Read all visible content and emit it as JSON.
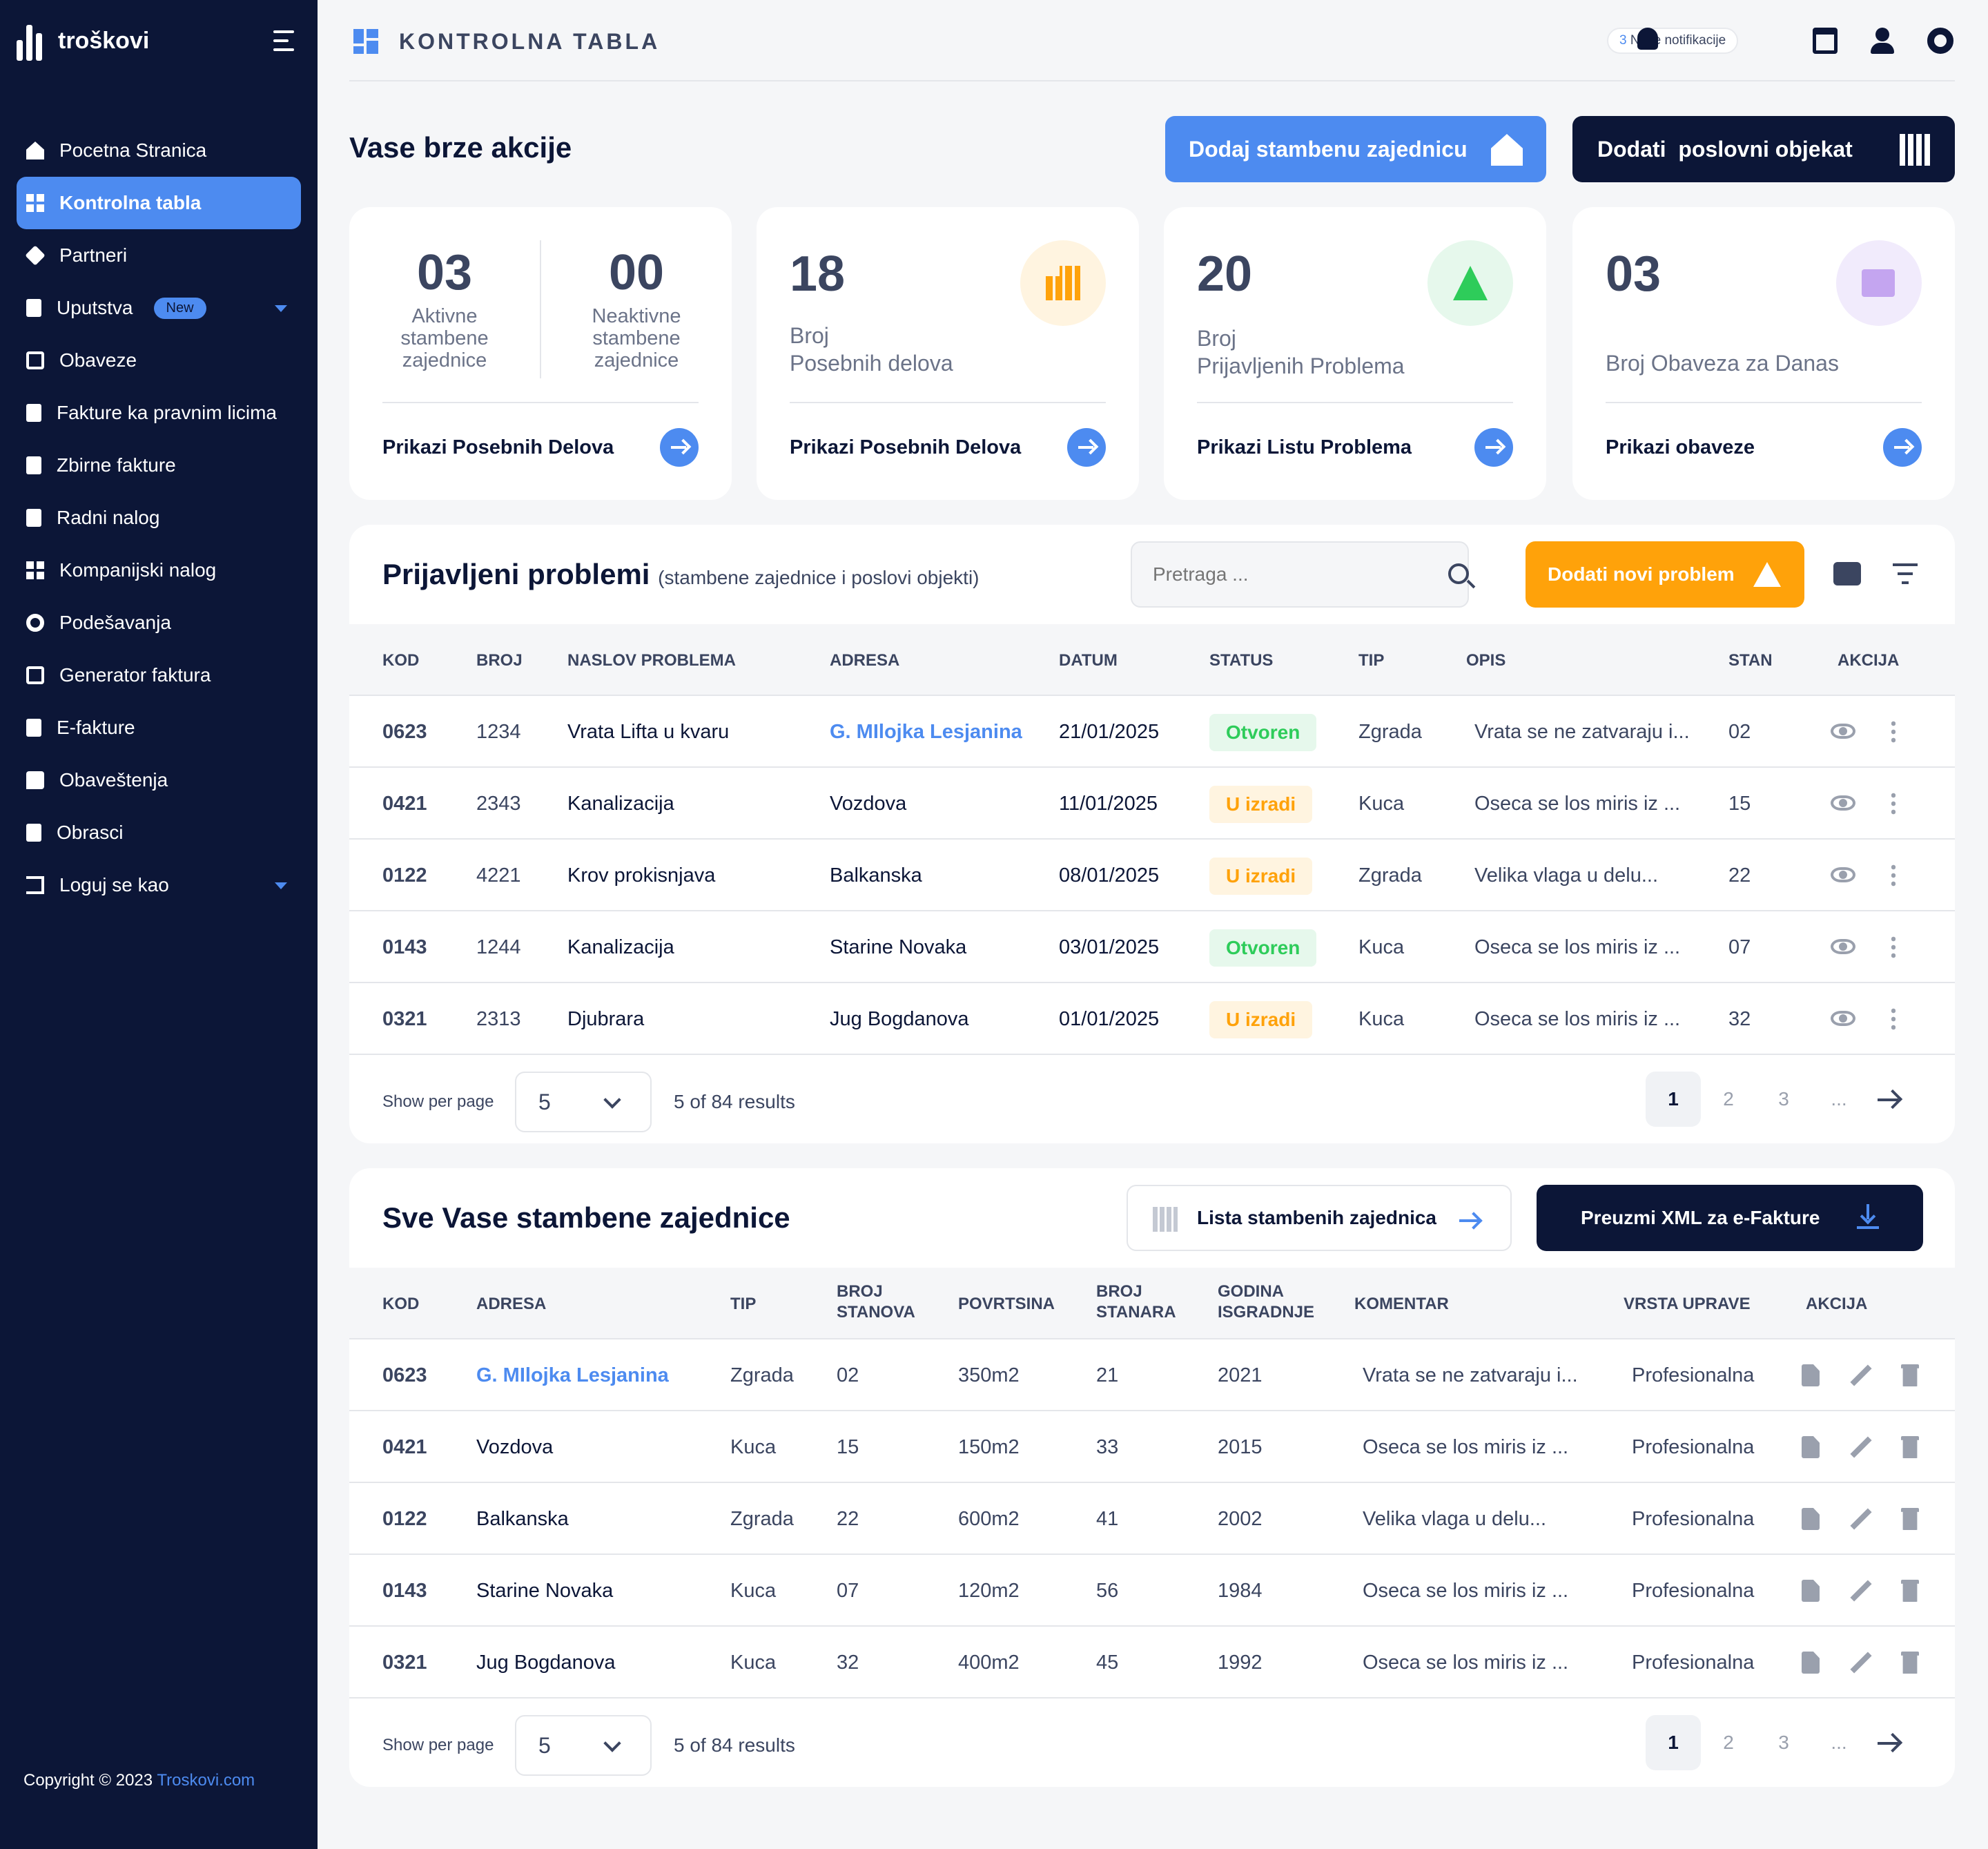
{
  "brand": {
    "name": "troškovi",
    "accent": "#4d8bf0",
    "navy": "#0c1637",
    "orange": "#ffa20a",
    "green": "#2ecc5a"
  },
  "sidebar": {
    "items": [
      {
        "label": "Pocetna Stranica",
        "icon": "home-icon"
      },
      {
        "label": "Kontrolna tabla",
        "icon": "dashboard-icon",
        "active": true
      },
      {
        "label": "Partneri",
        "icon": "handshake-icon"
      },
      {
        "label": "Uputstva",
        "icon": "document-icon",
        "badge": "New",
        "expandable": true
      },
      {
        "label": "Obaveze",
        "icon": "checklist-icon"
      },
      {
        "label": "Fakture ka pravnim licima",
        "icon": "invoice-icon"
      },
      {
        "label": "Zbirne fakture",
        "icon": "invoice-icon"
      },
      {
        "label": "Radni nalog",
        "icon": "invoice-icon"
      },
      {
        "label": "Kompanijski nalog",
        "icon": "building-icon"
      },
      {
        "label": "Podešavanja",
        "icon": "gear-icon"
      },
      {
        "label": "Generator faktura",
        "icon": "generator-icon"
      },
      {
        "label": "E-fakture",
        "icon": "file-icon"
      },
      {
        "label": "Obaveštenja",
        "icon": "chat-icon"
      },
      {
        "label": "Obrasci",
        "icon": "form-icon"
      },
      {
        "label": "Loguj se kao",
        "icon": "login-icon",
        "expandable": true
      }
    ],
    "copyright_prefix": "Copyright © 2023 ",
    "copyright_link": "Troskovi.com"
  },
  "topbar": {
    "title": "KONTROLNA TABLA",
    "notif_count": "3",
    "notif_text": " Nove notifikacije"
  },
  "quick": {
    "title": "Vase brze akcije",
    "add_community": "Dodaj stambenu zajednicu",
    "add_business": "Dodati  poslovni objekat"
  },
  "cards": [
    {
      "active_n": "03",
      "active_label": "Aktivne stambene zajednice",
      "inactive_n": "00",
      "inactive_label": "Neaktivne stambene zajednice",
      "link": "Prikazi Posebnih Delova"
    },
    {
      "n": "18",
      "label1": "Broj",
      "label2": "Posebnih delova",
      "link": "Prikazi Posebnih Delova",
      "icon": "building-icon",
      "icon_bg": "#fff4e0",
      "icon_color": "#ffa20a"
    },
    {
      "n": "20",
      "label1": "Broj",
      "label2": "Prijavljenih Problema",
      "link": "Prikazi Listu Problema",
      "icon": "warning-icon",
      "icon_bg": "#e6f8ec",
      "icon_color": "#2ecc5a"
    },
    {
      "n": "03",
      "label1": "",
      "label2": "Broj Obaveza za Danas",
      "link": "Prikazi obaveze",
      "icon": "task-icon",
      "icon_bg": "#f1ebfc",
      "icon_color": "#c4a5f0"
    }
  ],
  "problems": {
    "title": "Prijavljeni problemi",
    "subtitle": "(stambene zajednice i poslovi objekti)",
    "search_placeholder": "Pretraga ...",
    "add_label": "Dodati novi problem",
    "columns": [
      "KOD",
      "BROJ",
      "NASLOV PROBLEMA",
      "ADRESA",
      "DATUM",
      "STATUS",
      "TIP",
      "OPIS",
      "STAN",
      "AKCIJA"
    ],
    "rows": [
      {
        "kod": "0623",
        "broj": "1234",
        "naslov": "Vrata Lifta u kvaru",
        "adresa": "G. MIlojka Lesjanina",
        "adresa_link": true,
        "datum": "21/01/2025",
        "status": "Otvoren",
        "tip": "Zgrada",
        "opis": "Vrata se ne zatvaraju i...",
        "stan": "02"
      },
      {
        "kod": "0421",
        "broj": "2343",
        "naslov": "Kanalizacija",
        "adresa": "Vozdova",
        "adresa_link": false,
        "datum": "11/01/2025",
        "status": "U izradi",
        "tip": "Kuca",
        "opis": "Oseca se los miris iz ...",
        "stan": "15"
      },
      {
        "kod": "0122",
        "broj": "4221",
        "naslov": "Krov prokisnjava",
        "adresa": "Balkanska",
        "adresa_link": false,
        "datum": "08/01/2025",
        "status": "U izradi",
        "tip": "Zgrada",
        "opis": "Velika vlaga u delu...",
        "stan": "22"
      },
      {
        "kod": "0143",
        "broj": "1244",
        "naslov": "Kanalizacija",
        "adresa": "Starine Novaka",
        "adresa_link": false,
        "datum": "03/01/2025",
        "status": "Otvoren",
        "tip": "Kuca",
        "opis": "Oseca se los miris iz ...",
        "stan": "07"
      },
      {
        "kod": "0321",
        "broj": "2313",
        "naslov": "Djubrara",
        "adresa": "Jug Bogdanova",
        "adresa_link": false,
        "datum": "01/01/2025",
        "status": "U izradi",
        "tip": "Kuca",
        "opis": "Oseca se los miris iz ...",
        "stan": "32"
      }
    ],
    "show_per_page": "Show per page",
    "per_page": "5",
    "results": "5 of 84 results",
    "pages": [
      "1",
      "2",
      "3",
      "..."
    ]
  },
  "communities": {
    "title": "Sve Vase stambene zajednice",
    "list_label": "Lista stambenih zajednica",
    "xml_label": "Preuzmi XML za e-Fakture",
    "columns": [
      "KOD",
      "ADRESA",
      "TIP",
      "BROJ STANOVA",
      "POVRTSINA",
      "BROJ STANARA",
      "GODINA ISGRADNJE",
      "KOMENTAR",
      "VRSTA UPRAVE",
      "AKCIJA"
    ],
    "rows": [
      {
        "kod": "0623",
        "adresa": "G. MIlojka Lesjanina",
        "adresa_link": true,
        "tip": "Zgrada",
        "stanova": "02",
        "povrsina": "350m2",
        "stanara": "21",
        "godina": "2021",
        "komentar": "Vrata se ne zatvaraju i...",
        "uprava": "Profesionalna"
      },
      {
        "kod": "0421",
        "adresa": "Vozdova",
        "adresa_link": false,
        "tip": "Kuca",
        "stanova": "15",
        "povrsina": "150m2",
        "stanara": "33",
        "godina": "2015",
        "komentar": "Oseca se los miris iz ...",
        "uprava": "Profesionalna"
      },
      {
        "kod": "0122",
        "adresa": "Balkanska",
        "adresa_link": false,
        "tip": "Zgrada",
        "stanova": "22",
        "povrsina": "600m2",
        "stanara": "41",
        "godina": "2002",
        "komentar": "Velika vlaga u delu...",
        "uprava": "Profesionalna"
      },
      {
        "kod": "0143",
        "adresa": "Starine Novaka",
        "adresa_link": false,
        "tip": "Kuca",
        "stanova": "07",
        "povrsina": "120m2",
        "stanara": "56",
        "godina": "1984",
        "komentar": "Oseca se los miris iz ...",
        "uprava": "Profesionalna"
      },
      {
        "kod": "0321",
        "adresa": "Jug Bogdanova",
        "adresa_link": false,
        "tip": "Kuca",
        "stanova": "32",
        "povrsina": "400m2",
        "stanara": "45",
        "godina": "1992",
        "komentar": "Oseca se los miris iz ...",
        "uprava": "Profesionalna"
      }
    ],
    "show_per_page": "Show per page",
    "per_page": "5",
    "results": "5 of 84 results",
    "pages": [
      "1",
      "2",
      "3",
      "..."
    ]
  }
}
